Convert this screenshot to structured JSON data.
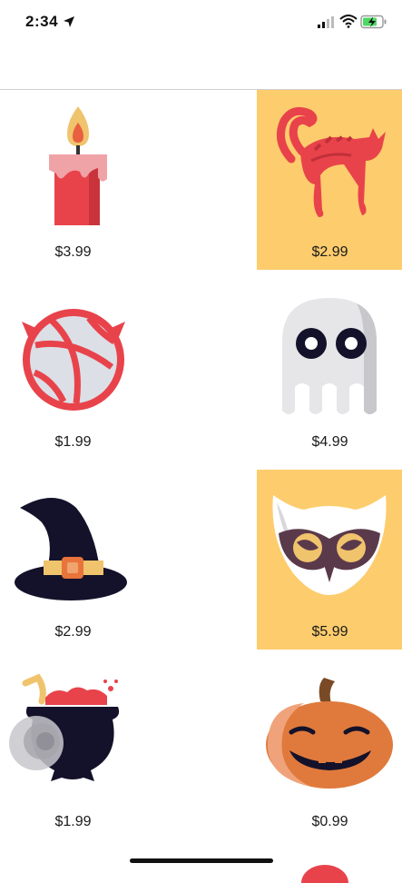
{
  "status": {
    "time": "2:34",
    "icons": [
      "location-arrow-icon",
      "cellular-signal-icon",
      "wifi-icon",
      "battery-charging-icon"
    ],
    "battery_color": "#4cd964"
  },
  "colors": {
    "selected_background": "#fdcc6d",
    "divider": "#cfcfcf"
  },
  "items": [
    {
      "name": "candle",
      "icon": "candle-icon",
      "price": "$3.99",
      "selected": false
    },
    {
      "name": "cat",
      "icon": "black-cat-icon",
      "price": "$2.99",
      "selected": true
    },
    {
      "name": "devil-ball",
      "icon": "devil-ball-icon",
      "price": "$1.99",
      "selected": false
    },
    {
      "name": "ghost",
      "icon": "ghost-icon",
      "price": "$4.99",
      "selected": false
    },
    {
      "name": "witch-hat",
      "icon": "witch-hat-icon",
      "price": "$2.99",
      "selected": false
    },
    {
      "name": "owl",
      "icon": "owl-icon",
      "price": "$5.99",
      "selected": true
    },
    {
      "name": "cauldron",
      "icon": "cauldron-icon",
      "price": "$1.99",
      "selected": false
    },
    {
      "name": "pumpkin",
      "icon": "pumpkin-icon",
      "price": "$0.99",
      "selected": false
    }
  ]
}
